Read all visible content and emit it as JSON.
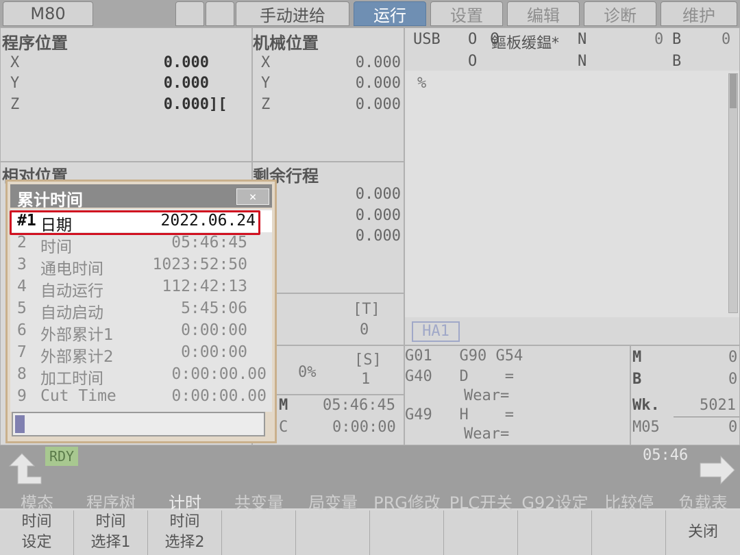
{
  "topbar": {
    "mode": "M80",
    "feed_mode": "手动进给",
    "tabs": [
      "运行",
      "设置",
      "编辑",
      "诊断",
      "维护"
    ]
  },
  "prog_pos": {
    "title": "程序位置",
    "axes": [
      {
        "axis": "X",
        "value": "0.000"
      },
      {
        "axis": "Y",
        "value": "0.000"
      },
      {
        "axis": "Z",
        "value": "0.000"
      }
    ],
    "z_suffix": "][",
    "rel_title": "相对位置"
  },
  "mach_pos": {
    "title": "机械位置",
    "axes": [
      {
        "axis": "X",
        "value": "0.000"
      },
      {
        "axis": "Y",
        "value": "0.000"
      },
      {
        "axis": "Z",
        "value": "0.000"
      }
    ],
    "remain_title": "剩余行程",
    "remain": [
      "0.000",
      "0.000",
      "0.000"
    ],
    "t_label": "[T]",
    "t_value": "0",
    "override": "0%",
    "s_label": "[S]",
    "s_value": "1",
    "m_label": "M",
    "m_time": "05:46:45",
    "c_label": "C",
    "c_time": "0:00:00"
  },
  "program": {
    "device": "USB",
    "o1": "O",
    "o1_value": "0",
    "name": "鏂板缓鎾*",
    "n1": "N",
    "n1_value": "0",
    "b1": "B",
    "b1_value": "0",
    "o2": "O",
    "n2": "N",
    "b2": "B",
    "content": "%",
    "ha_label": "HA1"
  },
  "modal": {
    "g_row1": "G01   G90 G54",
    "g_row2": "G40   D    =",
    "wear1": "Wear=",
    "g_row3": "G49   H    =",
    "wear2": "Wear=",
    "m_label": "M",
    "m_value": "0",
    "b_label": "B",
    "b_value": "0",
    "wk_label": "Wk.",
    "wk_value": "5021",
    "m05_label": "M05",
    "m05_value": "0"
  },
  "dialog": {
    "title": "累计时间",
    "close": "×",
    "rows": [
      {
        "num": "#1",
        "label": "日期",
        "value": "2022.06.24"
      },
      {
        "num": "2",
        "label": "时间",
        "value": "05:46:45"
      },
      {
        "num": "3",
        "label": "通电时间",
        "value": "1023:52:50"
      },
      {
        "num": "4",
        "label": "自动运行",
        "value": "112:42:13"
      },
      {
        "num": "5",
        "label": "自动启动",
        "value": "5:45:06"
      },
      {
        "num": "6",
        "label": "外部累计1",
        "value": "0:00:00"
      },
      {
        "num": "7",
        "label": "外部累计2",
        "value": "0:00:00"
      },
      {
        "num": "8",
        "label": "加工时间",
        "value": "0:00:00.00"
      },
      {
        "num": "9",
        "label": "Cut Time",
        "value": "0:00:00.00"
      }
    ]
  },
  "status": {
    "rdy": "RDY",
    "clock": "05:46"
  },
  "menu_top": [
    "模态",
    "程序树",
    "计时",
    "共变量",
    "局变量",
    "PRG修改",
    "PLC开关",
    "G92设定",
    "比较停",
    "负载表"
  ],
  "softkeys": [
    {
      "line1": "时间",
      "line2": "设定"
    },
    {
      "line1": "时间",
      "line2": "选择1"
    },
    {
      "line1": "时间",
      "line2": "选择2"
    },
    {
      "line1": "",
      "line2": ""
    },
    {
      "line1": "",
      "line2": ""
    },
    {
      "line1": "",
      "line2": ""
    },
    {
      "line1": "",
      "line2": ""
    },
    {
      "line1": "",
      "line2": ""
    },
    {
      "line1": "",
      "line2": ""
    },
    {
      "line1": "关闭",
      "line2": ""
    }
  ]
}
